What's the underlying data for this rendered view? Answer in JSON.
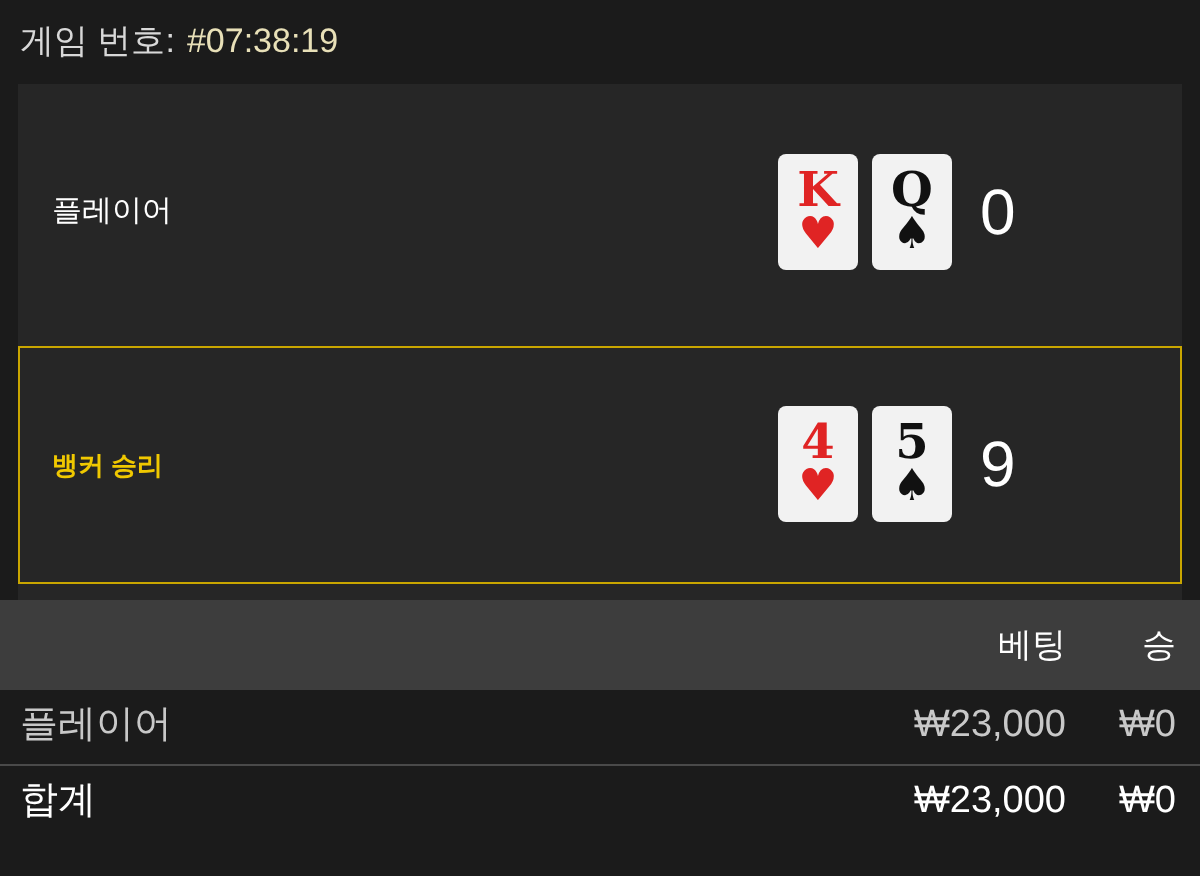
{
  "header": {
    "label": "게임 번호:",
    "value": "#07:38:19"
  },
  "hands": [
    {
      "label": "플레이어",
      "winner": false,
      "score": "0",
      "cards": [
        {
          "rank": "K",
          "suit": "♥",
          "color": "#e02424"
        },
        {
          "rank": "Q",
          "suit": "♠",
          "color": "#111111"
        }
      ]
    },
    {
      "label": "뱅커 승리",
      "winner": true,
      "score": "9",
      "cards": [
        {
          "rank": "4",
          "suit": "♥",
          "color": "#e02424"
        },
        {
          "rank": "5",
          "suit": "♠",
          "color": "#111111"
        }
      ]
    }
  ],
  "table": {
    "columns": [
      "",
      "베팅",
      "승"
    ],
    "rows": [
      {
        "kind": "bet",
        "cells": [
          "플레이어",
          "₩23,000",
          "₩0"
        ]
      },
      {
        "kind": "total",
        "cells": [
          "합계",
          "₩23,000",
          "₩0"
        ]
      }
    ]
  }
}
